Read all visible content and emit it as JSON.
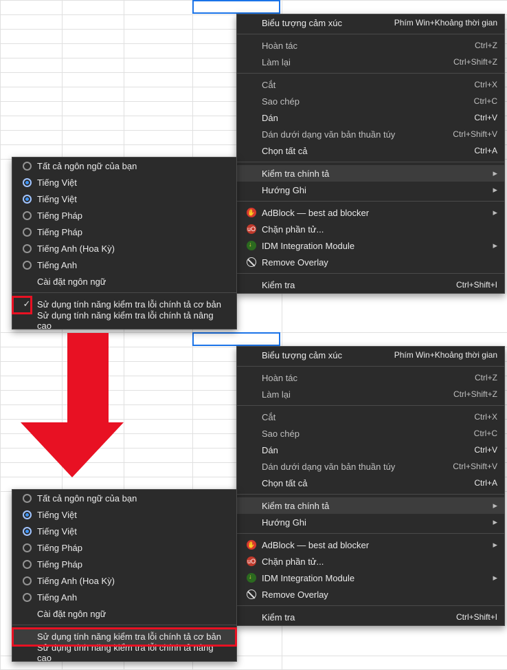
{
  "main_menu": {
    "emoji": {
      "label": "Biểu tượng cảm xúc",
      "shortcut": "Phím Win+Khoảng thời gian"
    },
    "undo": {
      "label": "Hoàn tác",
      "shortcut": "Ctrl+Z"
    },
    "redo": {
      "label": "Làm lại",
      "shortcut": "Ctrl+Shift+Z"
    },
    "cut": {
      "label": "Cắt",
      "shortcut": "Ctrl+X"
    },
    "copy": {
      "label": "Sao chép",
      "shortcut": "Ctrl+C"
    },
    "paste": {
      "label": "Dán",
      "shortcut": "Ctrl+V"
    },
    "paste_plain": {
      "label": "Dán dưới dạng văn bản thuần túy",
      "shortcut": "Ctrl+Shift+V"
    },
    "select_all": {
      "label": "Chọn tất cả",
      "shortcut": "Ctrl+A"
    },
    "spellcheck": {
      "label": "Kiểm tra chính tả"
    },
    "writing_dir": {
      "label": "Hướng Ghi"
    },
    "adblock": {
      "label": "AdBlock — best ad blocker"
    },
    "block_el": {
      "label": "Chặn phần tử..."
    },
    "idm": {
      "label": "IDM Integration Module"
    },
    "overlay": {
      "label": "Remove Overlay"
    },
    "inspect": {
      "label": "Kiểm tra",
      "shortcut": "Ctrl+Shift+I"
    }
  },
  "sub_menu": {
    "all_lang": {
      "label": "Tất cả ngôn ngữ của bạn"
    },
    "viet1": {
      "label": "Tiếng Việt"
    },
    "viet2": {
      "label": "Tiếng Việt"
    },
    "fr1": {
      "label": "Tiếng Pháp"
    },
    "fr2": {
      "label": "Tiếng Pháp"
    },
    "en_us": {
      "label": "Tiếng Anh (Hoa Kỳ)"
    },
    "en": {
      "label": "Tiếng Anh"
    },
    "lang_settings": {
      "label": "Cài đặt ngôn ngữ"
    },
    "basic": {
      "label": "Sử dụng tính năng kiểm tra lỗi chính tả cơ bản"
    },
    "advanced": {
      "label": "Sử dụng tính năng kiểm tra lỗi chính tả nâng cao"
    }
  }
}
